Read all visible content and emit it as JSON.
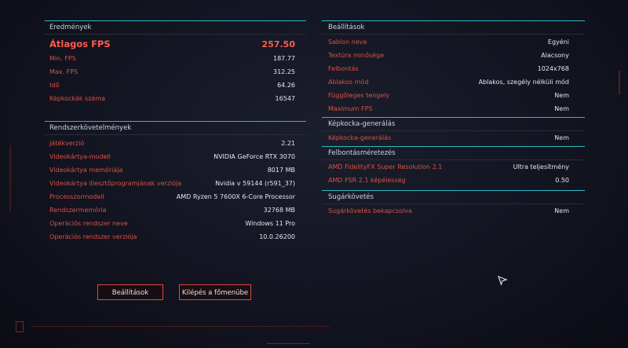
{
  "results": {
    "title": "Eredmények",
    "rows": [
      {
        "label": "Átlagos FPS",
        "value": "257.50"
      },
      {
        "label": "Min. FPS",
        "value": "187.77"
      },
      {
        "label": "Max. FPS",
        "value": "312.25"
      },
      {
        "label": "Idő",
        "value": "64.26"
      },
      {
        "label": "Képkockák száma",
        "value": "16547"
      }
    ]
  },
  "system": {
    "title": "Rendszerkövetelmények",
    "rows": [
      {
        "label": "Játékverzió",
        "value": "2.21"
      },
      {
        "label": "Videokártya-modell",
        "value": "NVIDIA GeForce RTX 3070"
      },
      {
        "label": "Videokártya memóriája",
        "value": "8017 MB"
      },
      {
        "label": "Videokártya illesztőprogramjának verziója",
        "value": "Nvidia v 59144 (r591_37)"
      },
      {
        "label": "Processzormodell",
        "value": "AMD Ryzen 5 7600X 6-Core Processor"
      },
      {
        "label": "Rendszermemória",
        "value": "32768 MB"
      },
      {
        "label": "Operációs rendszer neve",
        "value": "Windows 11 Pro"
      },
      {
        "label": "Operációs rendszer verziója",
        "value": "10.0.26200"
      }
    ]
  },
  "settings": {
    "title": "Beállítások",
    "rows": [
      {
        "label": "Sablon neve",
        "value": "Egyéni"
      },
      {
        "label": "Textúra minősége",
        "value": "Alacsony"
      },
      {
        "label": "Felbontás",
        "value": "1024x768"
      },
      {
        "label": "Ablakos mód",
        "value": "Ablakos, szegély nélküli mód"
      },
      {
        "label": "Függőleges tengely",
        "value": "Nem"
      },
      {
        "label": "Maximum FPS",
        "value": "Nem"
      }
    ]
  },
  "frame_gen": {
    "title": "Képkocka-generálás",
    "rows": [
      {
        "label": "Képkocka-generálás",
        "value": "Nem"
      }
    ]
  },
  "upscaling": {
    "title": "Felbontásméretezés",
    "rows": [
      {
        "label": "AMD FidelityFX Super Resolution 2.1",
        "value": "Ultra teljesítmény"
      },
      {
        "label": "AMD FSR 2.1 képélesség",
        "value": "0.50"
      }
    ]
  },
  "raytracing": {
    "title": "Sugárkövetés",
    "rows": [
      {
        "label": "Sugárkövetés bekapcsolva",
        "value": "Nem"
      }
    ]
  },
  "buttons": {
    "settings": "Beállítások",
    "main_menu": "Kilépés a főmenübe"
  },
  "colors": {
    "accent_red": "#e65a50",
    "accent_cyan": "#2fb8c4",
    "value_white": "#e4e6ee"
  }
}
